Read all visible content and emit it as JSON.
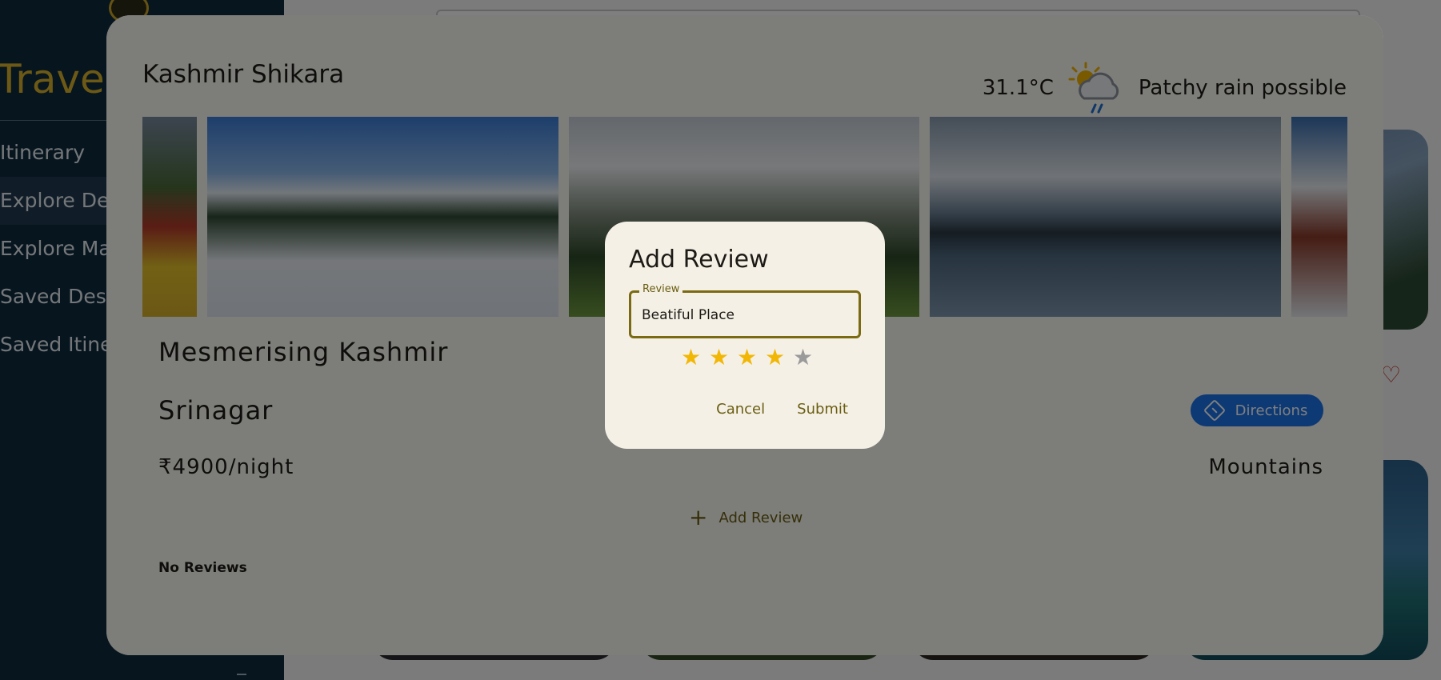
{
  "sidebar": {
    "brand": "Travel",
    "items": [
      {
        "label": "Itinerary"
      },
      {
        "label": "Explore Destinations"
      },
      {
        "label": "Explore Map"
      },
      {
        "label": "Saved Destinations"
      },
      {
        "label": "Saved Itineraries"
      }
    ]
  },
  "detail": {
    "title": "Kashmir Shikara",
    "weather": {
      "temperature": "31.1°C",
      "condition": "Patchy rain possible",
      "icon": "partly-cloudy-rain-icon"
    },
    "name": "Mesmerising Kashmir",
    "city": "Srinagar",
    "price": "₹4900/night",
    "category": "Mountains",
    "directions_label": "Directions",
    "add_review_label": "Add Review",
    "no_reviews": "No Reviews"
  },
  "review_dialog": {
    "heading": "Add Review",
    "field_label": "Review",
    "field_value": "Beatiful Place",
    "rating": 4,
    "max_rating": 5,
    "cancel_label": "Cancel",
    "submit_label": "Submit"
  },
  "colors": {
    "sidebar_bg": "#0e2a3e",
    "brand": "#d9b32a",
    "accent": "#6b5e12",
    "directions": "#1a73e8",
    "star_on": "#f2b705",
    "star_off": "#9a9a9a"
  }
}
